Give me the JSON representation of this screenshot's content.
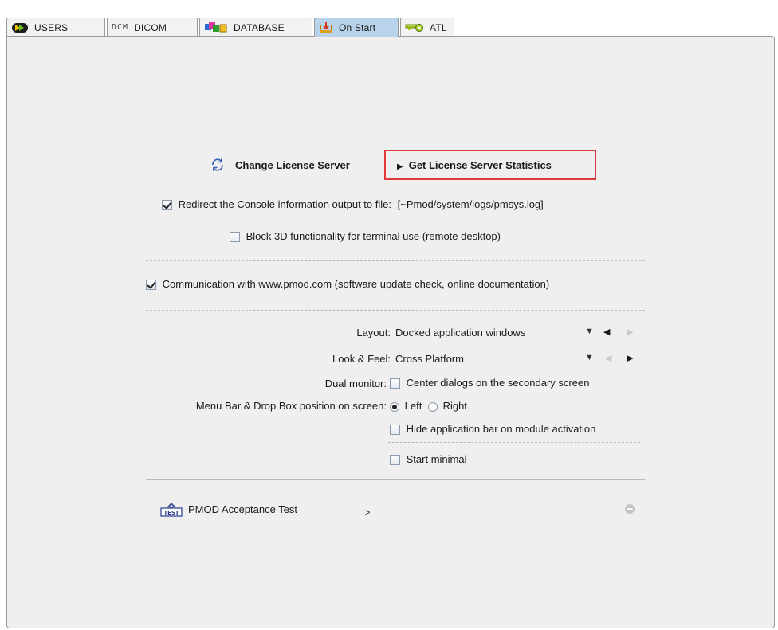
{
  "tabs": [
    {
      "label": "USERS",
      "icon": "users-icon"
    },
    {
      "label": "DICOM",
      "icon": "dcm-icon",
      "icon_text": "DCM"
    },
    {
      "label": "DATABASE",
      "icon": "database-icon"
    },
    {
      "label": "On Start",
      "icon": "on-start-icon",
      "active": true
    },
    {
      "label": "ATL",
      "icon": "key-icon"
    }
  ],
  "license": {
    "change_label": "Change License Server",
    "stats_label": "Get License Server Statistics",
    "highlight_color": "#e03a3a"
  },
  "console": {
    "redirect_label": "Redirect the Console information output to file:",
    "redirect_checked": true,
    "log_path": "[~Pmod/system/logs/pmsys.log]",
    "block3d_label": "Block 3D functionality for terminal use (remote desktop)",
    "block3d_checked": false
  },
  "communication": {
    "label": "Communication with www.pmod.com (software update check, online documentation)",
    "checked": true
  },
  "settings": {
    "layout_label": "Layout:",
    "layout_value": "Docked application windows",
    "lookfeel_label": "Look & Feel:",
    "lookfeel_value": "Cross Platform",
    "dual_label": "Dual monitor:",
    "dual_option": "Center dialogs on the secondary screen",
    "dual_checked": false,
    "menubar_label": "Menu Bar & Drop Box position on screen:",
    "radio_left": "Left",
    "radio_right": "Right",
    "selected": "Left",
    "hide_appbar_label": "Hide application bar on module activation",
    "hide_appbar_checked": false,
    "start_minimal_label": "Start minimal",
    "start_minimal_checked": false
  },
  "acceptance": {
    "icon_text": "TEST",
    "label": "PMOD Acceptance Test",
    "arrow": ">"
  },
  "colors": {
    "active_tab": "#b8d3ea",
    "panel_bg": "#efefef"
  }
}
